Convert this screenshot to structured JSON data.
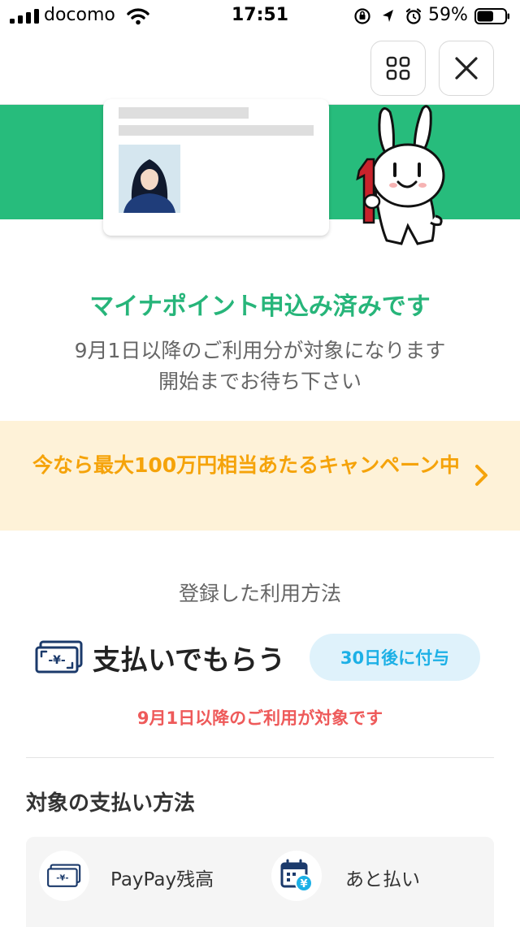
{
  "status_bar": {
    "carrier": "docomo",
    "time": "17:51",
    "battery_percent": "59%",
    "battery_level": 0.59
  },
  "hero": {
    "title": "マイナポイント申込み済みです",
    "subtitle_line1": "9月1日以降のご利用分が対象になります",
    "subtitle_line2": "開始までお待ち下さい"
  },
  "campaign": {
    "text": "今なら最大100万円相当あたるキャンペーン中"
  },
  "registration": {
    "section_label": "登録した利用方法",
    "method_name": "支払いでもらう",
    "badge": "30日後に付与",
    "note": "9月1日以降のご利用が対象です"
  },
  "payment_methods": {
    "heading": "対象の支払い方法",
    "items": [
      {
        "label": "PayPay残高",
        "icon": "yen-bill-icon"
      },
      {
        "label": "あと払い",
        "icon": "calendar-yen-icon"
      }
    ]
  },
  "colors": {
    "brand_green": "#27bc7c",
    "title_green": "#27b57a",
    "campaign_bg": "#fef2d8",
    "campaign_text": "#f5a30a",
    "badge_bg": "#dff2fb",
    "badge_text": "#1cb0e6",
    "note_red": "#ee5a5a",
    "icon_navy": "#1b3a6b"
  }
}
